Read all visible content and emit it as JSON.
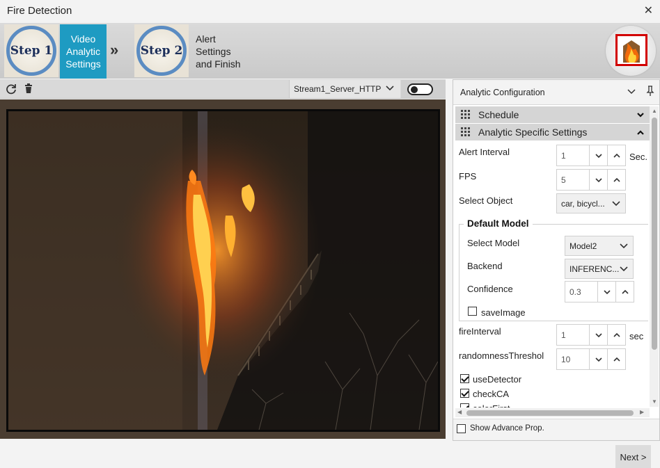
{
  "window": {
    "title": "Fire Detection",
    "close_glyph": "✕"
  },
  "steps": {
    "step1": {
      "badge": "Step 1",
      "label": "Video Analytic Settings"
    },
    "step2": {
      "badge": "Step 2",
      "label": "Alert Settings and Finish"
    },
    "separator": "»",
    "logo_icon": "fire-building-icon"
  },
  "toolbar": {
    "refresh_icon": "refresh-icon",
    "delete_icon": "trash-icon",
    "stream": "Stream1_Server_HTTP",
    "toggle_on": false
  },
  "panel": {
    "title": "Analytic Configuration",
    "sections": {
      "schedule": "Schedule",
      "analytic": "Analytic Specific Settings"
    },
    "alert_interval": {
      "label": "Alert Interval",
      "value": "1",
      "unit": "Sec."
    },
    "fps": {
      "label": "FPS",
      "value": "5"
    },
    "select_object": {
      "label": "Select Object",
      "value": "car, bicycl..."
    },
    "default_model": {
      "legend": "Default Model",
      "select_model": {
        "label": "Select Model",
        "value": "Model2"
      },
      "backend": {
        "label": "Backend",
        "value": "INFERENC..."
      },
      "confidence": {
        "label": "Confidence",
        "value": "0.3"
      },
      "save_image": {
        "label": "saveImage",
        "checked": false
      }
    },
    "fire_interval": {
      "label": "fireInterval",
      "value": "1",
      "unit": "sec"
    },
    "randomness": {
      "label": "randomnessThreshol",
      "value": "10"
    },
    "use_detector": {
      "label": "useDetector",
      "checked": true
    },
    "check_ca": {
      "label": "checkCA",
      "checked": true
    },
    "color_first": {
      "label": "colorFirst",
      "checked": true
    },
    "show_advance": {
      "label": "Show Advance Prop.",
      "checked": false
    }
  },
  "footer": {
    "next": "Next >"
  },
  "colors": {
    "accent": "#1e9bc2",
    "ring": "#5b8cc2",
    "alert_red": "#d20000"
  }
}
